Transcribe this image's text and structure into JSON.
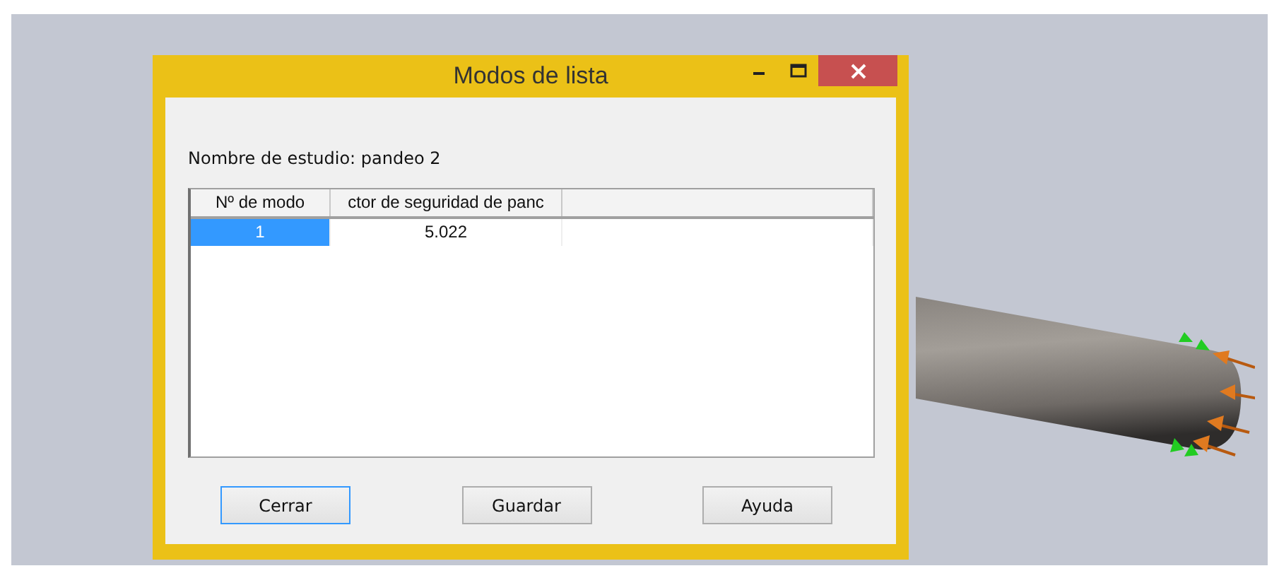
{
  "window": {
    "title": "Modos de lista"
  },
  "study_label": "Nombre de estudio: pandeo 2",
  "table": {
    "columns": [
      "Nº de modo",
      "ctor de seguridad de panc"
    ],
    "rows": [
      {
        "cells": [
          "1",
          "5.022"
        ],
        "selected": true
      }
    ]
  },
  "buttons": [
    {
      "label": "Cerrar",
      "focused": true
    },
    {
      "label": "Guardar",
      "focused": false
    },
    {
      "label": "Ayuda",
      "focused": false
    }
  ]
}
